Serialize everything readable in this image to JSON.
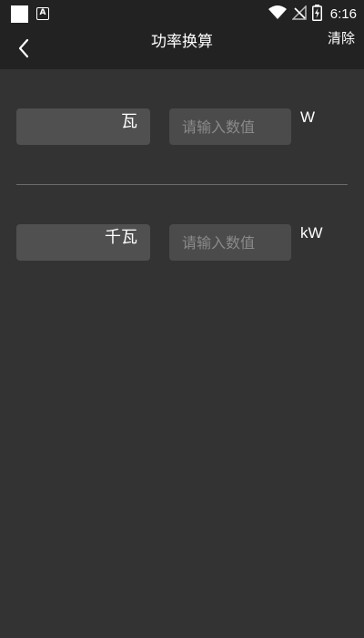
{
  "status_bar": {
    "time": "6:16",
    "app_icon_letter": "A",
    "icons": [
      "wifi-icon",
      "no-signal-icon",
      "battery-charging-icon"
    ]
  },
  "header": {
    "title": "功率换算",
    "clear_label": "清除",
    "back_icon": "chevron-left-icon"
  },
  "rows": [
    {
      "unit_name": "瓦",
      "input_value": "",
      "placeholder": "请输入数值",
      "symbol": "W"
    },
    {
      "unit_name": "千瓦",
      "input_value": "",
      "placeholder": "请输入数值",
      "symbol": "kW"
    }
  ],
  "colors": {
    "background": "#333333",
    "bar_background": "#222222",
    "label_box": "#505050",
    "input_box": "#4b4b4b",
    "placeholder": "#8a8a8a",
    "text": "#ffffff"
  }
}
